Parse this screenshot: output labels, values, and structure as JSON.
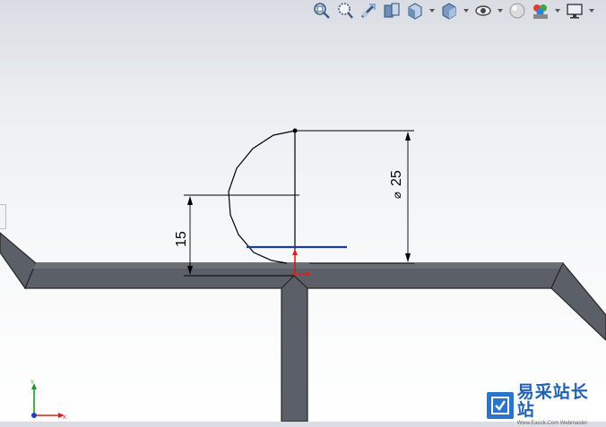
{
  "toolbar": {
    "buttons": [
      {
        "icon": "zoom-to-fit-icon",
        "has_dropdown": false
      },
      {
        "icon": "zoom-to-area-icon",
        "has_dropdown": false
      },
      {
        "icon": "previous-view-icon",
        "has_dropdown": false
      },
      {
        "icon": "section-view-icon",
        "has_dropdown": false
      },
      {
        "icon": "view-orientation-icon",
        "has_dropdown": true
      },
      {
        "icon": "display-style-icon",
        "has_dropdown": true
      },
      {
        "icon": "hide-show-items-icon",
        "has_dropdown": true
      },
      {
        "icon": "edit-appearance-icon",
        "has_dropdown": false
      },
      {
        "icon": "apply-scene-icon",
        "has_dropdown": true
      },
      {
        "icon": "view-settings-icon",
        "has_dropdown": true
      }
    ]
  },
  "sketch": {
    "dimension_diameter": "25",
    "dimension_height": "15",
    "diameter_symbol": "⌀"
  },
  "triad": {
    "y_label": "Y",
    "x_label": "X"
  },
  "watermark": {
    "title": "易采站长站",
    "subtitle": "Www.Easck.Com  Webmaster"
  },
  "colors": {
    "tube": "#5b5f68",
    "tube_edge": "#262626",
    "sketch": "#000000",
    "horizontal_line": "#1a3c9e",
    "origin_x": "#e02020",
    "origin_y": "#e02020",
    "triad_y": "#1a9a2a",
    "triad_x": "#d42020",
    "triad_z": "#2040c0"
  }
}
